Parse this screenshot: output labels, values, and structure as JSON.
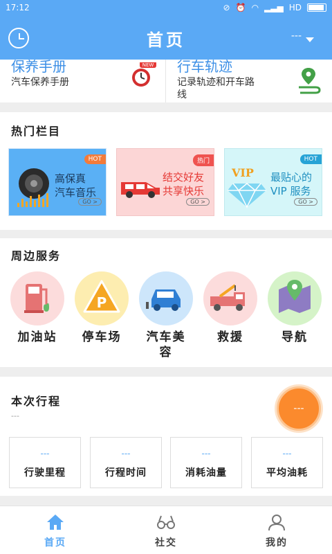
{
  "status_bar": {
    "time": "17:12",
    "network": "HD"
  },
  "header": {
    "title": "首页",
    "user": "---"
  },
  "top_cards": [
    {
      "title": "保养手册",
      "subtitle": "汽车保养手册",
      "badge": "NEW"
    },
    {
      "title": "行车轨迹",
      "subtitle_line1": "记录轨迹和开车路",
      "subtitle_line2": "线"
    }
  ],
  "hot_section": {
    "title": "热门栏目",
    "items": [
      {
        "tag": "HOT",
        "line1": "高保真",
        "line2": "汽车音乐",
        "go": "GO >"
      },
      {
        "tag": "热门",
        "line1": "结交好友",
        "line2": "共享快乐",
        "go": "GO >"
      },
      {
        "tag": "HOT",
        "line1": "最贴心的",
        "line2": "VIP 服务",
        "go": "GO >",
        "vip": "VIP"
      }
    ]
  },
  "services_section": {
    "title": "周边服务",
    "items": [
      {
        "label": "加油站",
        "icon": "gas-station-icon"
      },
      {
        "label": "停车场",
        "icon": "parking-icon"
      },
      {
        "label_line1": "汽车美",
        "label_line2": "容",
        "icon": "car-wash-icon"
      },
      {
        "label": "救援",
        "icon": "tow-truck-icon"
      },
      {
        "label": "导航",
        "icon": "map-pin-icon"
      }
    ]
  },
  "trip_section": {
    "title": "本次行程",
    "subtitle": "---",
    "badge": "---",
    "stats": [
      {
        "value": "---",
        "label": "行驶里程"
      },
      {
        "value": "---",
        "label": "行程时间"
      },
      {
        "value": "---",
        "label": "消耗油量"
      },
      {
        "value": "---",
        "label": "平均油耗"
      }
    ]
  },
  "tab_bar": {
    "tabs": [
      {
        "label": "首页",
        "icon": "home-icon",
        "active": true
      },
      {
        "label": "社交",
        "icon": "glasses-icon",
        "active": false
      },
      {
        "label": "我的",
        "icon": "person-icon",
        "active": false
      }
    ]
  },
  "colors": {
    "primary": "#5aa9f5",
    "accent": "#fb8a2d"
  }
}
